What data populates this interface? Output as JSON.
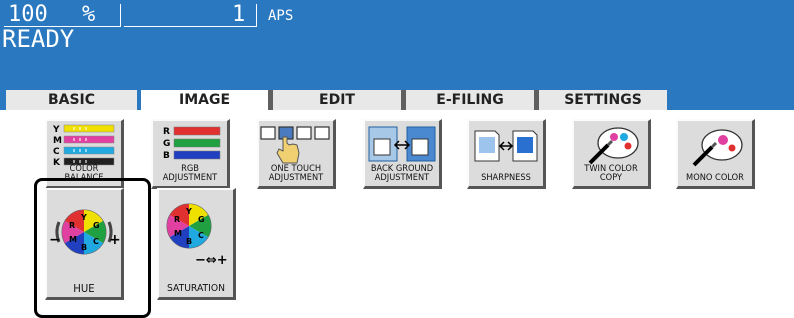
{
  "status": {
    "zoom_value": "100",
    "zoom_unit": "%",
    "copies": "1",
    "paper": "APS",
    "message": "READY"
  },
  "tabs": [
    {
      "label": "BASIC",
      "active": false
    },
    {
      "label": "IMAGE",
      "active": true
    },
    {
      "label": "EDIT",
      "active": false
    },
    {
      "label": "E-FILING",
      "active": false
    },
    {
      "label": "SETTINGS",
      "active": false
    }
  ],
  "buttons": {
    "color_balance": {
      "label": "COLOR BALANCE",
      "rows": [
        "Y",
        "M",
        "C",
        "K"
      ]
    },
    "rgb_adjustment": {
      "label": "RGB\nADJUSTMENT",
      "rows": [
        "R",
        "G",
        "B"
      ]
    },
    "one_touch": {
      "label": "ONE TOUCH\nADJUSTMENT"
    },
    "background": {
      "label": "BACK GROUND\nADJUSTMENT"
    },
    "sharpness": {
      "label": "SHARPNESS"
    },
    "twin_color": {
      "label": "TWIN COLOR\nCOPY"
    },
    "mono_color": {
      "label": "MONO COLOR"
    },
    "hue": {
      "label": "HUE"
    },
    "saturation": {
      "label": "SATURATION"
    }
  },
  "colors": {
    "status_blue": "#2a78c0",
    "yellow": "#f0e000",
    "magenta": "#e040a0",
    "cyan": "#20a8e0",
    "black": "#202020",
    "red": "#e03030",
    "green": "#20a040",
    "blue": "#2040c0"
  }
}
